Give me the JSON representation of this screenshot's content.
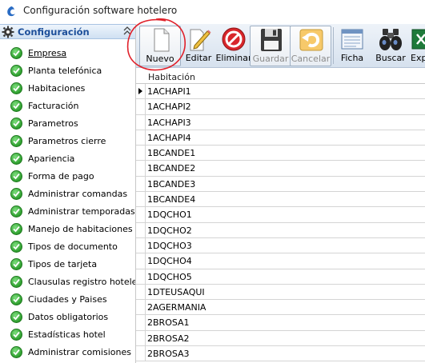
{
  "window": {
    "title": "Configuración software hotelero"
  },
  "sidebar": {
    "title": "Configuración",
    "items": [
      {
        "label": "Empresa",
        "active": true
      },
      {
        "label": "Planta telefónica"
      },
      {
        "label": "Habitaciones"
      },
      {
        "label": "Facturación"
      },
      {
        "label": "Parametros"
      },
      {
        "label": "Parametros cierre"
      },
      {
        "label": "Apariencia"
      },
      {
        "label": "Forma de pago"
      },
      {
        "label": "Administrar comandas"
      },
      {
        "label": "Administrar temporadas"
      },
      {
        "label": "Manejo de habitaciones"
      },
      {
        "label": "Tipos de documento"
      },
      {
        "label": "Tipos de tarjeta"
      },
      {
        "label": "Clausulas registro hotelero"
      },
      {
        "label": "Ciudades y Paises"
      },
      {
        "label": "Datos obligatorios"
      },
      {
        "label": "Estadísticas hotel"
      },
      {
        "label": "Administrar comisiones"
      }
    ]
  },
  "toolbar": {
    "buttons": [
      {
        "label": "Nuevo",
        "icon": "new-document-icon",
        "enabled": true
      },
      {
        "label": "Editar",
        "icon": "pencil-icon",
        "enabled": true
      },
      {
        "label": "Eliminar",
        "icon": "delete-icon",
        "enabled": true
      },
      {
        "label": "Guardar",
        "icon": "floppy-disk-icon",
        "enabled": false
      },
      {
        "label": "Cancelar",
        "icon": "undo-icon",
        "enabled": false
      },
      {
        "label": "Ficha",
        "icon": "form-icon",
        "enabled": true
      },
      {
        "label": "Buscar",
        "icon": "binoculars-icon",
        "enabled": true
      },
      {
        "label": "Exp",
        "icon": "excel-icon",
        "enabled": true
      }
    ]
  },
  "grid": {
    "column": "Habitación",
    "rows": [
      "1ACHAPI1",
      "1ACHAPI2",
      "1ACHAPI3",
      "1ACHAPI4",
      "1BCANDE1",
      "1BCANDE2",
      "1BCANDE3",
      "1BCANDE4",
      "1DQCHO1",
      "1DQCHO2",
      "1DQCHO3",
      "1DQCHO4",
      "1DQCHO5",
      "1DTEUSAQUI",
      "2AGERMANIA",
      "2BROSA1",
      "2BROSA2",
      "2BROSA3"
    ],
    "current_row": 0
  },
  "colors": {
    "accent": "#1d4f9a",
    "annotation": "#e0202a",
    "check": "#2e9e2e"
  }
}
